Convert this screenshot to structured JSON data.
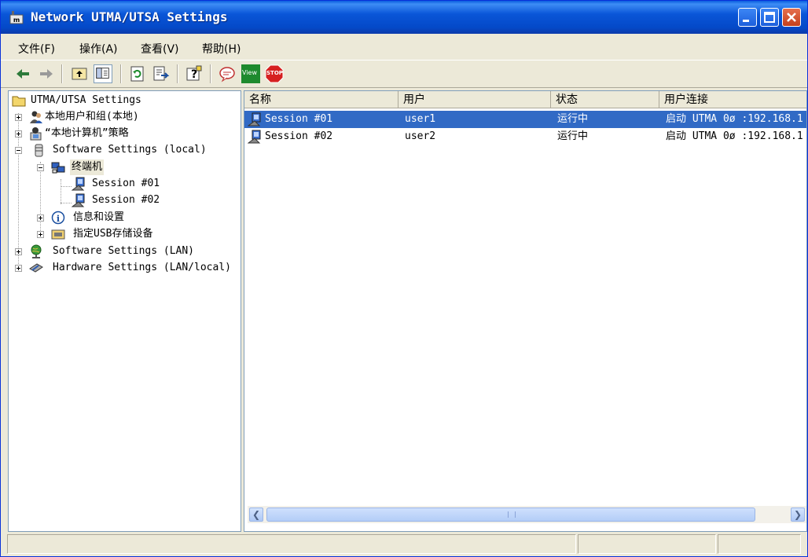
{
  "window": {
    "title": "Network UTMA/UTSA Settings",
    "colors": {
      "titlebar": "#0a56d8",
      "selection": "#316ac5",
      "close": "#c4401c"
    }
  },
  "menu": [
    {
      "label": "文件(F)"
    },
    {
      "label": "操作(A)"
    },
    {
      "label": "查看(V)"
    },
    {
      "label": "帮助(H)"
    }
  ],
  "toolbar": {
    "buttons": [
      "back-arrow-icon",
      "forward-arrow-icon",
      "up-folder-icon",
      "show-hide-tree-icon",
      "refresh-icon",
      "export-list-icon",
      "help-icon",
      "message-icon",
      "view-icon",
      "stop-icon"
    ],
    "view_label": "View",
    "stop_label": "STOP"
  },
  "tree": {
    "root": "UTMA/UTSA Settings",
    "items": [
      {
        "label": "本地用户和组(本地)",
        "icon": "users-icon"
      },
      {
        "label": "“本地计算机”策略",
        "icon": "policy-icon"
      },
      {
        "label": "Software Settings (local)",
        "icon": "database-icon"
      },
      {
        "label": "终端机",
        "icon": "terminal-icon"
      },
      {
        "label": "Session #01",
        "icon": "session-icon"
      },
      {
        "label": "Session #02",
        "icon": "session-icon"
      },
      {
        "label": "信息和设置",
        "icon": "info-icon"
      },
      {
        "label": "指定USB存储设备",
        "icon": "usb-storage-icon"
      },
      {
        "label": "Software Settings (LAN)",
        "icon": "globe-icon"
      },
      {
        "label": "Hardware Settings (LAN/local)",
        "icon": "hardware-icon"
      }
    ]
  },
  "list": {
    "columns": [
      "名称",
      "用户",
      "状态",
      "用户连接"
    ],
    "rows": [
      {
        "name": "Session #01",
        "user": "user1",
        "status": "运行中",
        "connection": "启动 UTMA 0ø :192.168.1"
      },
      {
        "name": "Session #02",
        "user": "user2",
        "status": "运行中",
        "connection": "启动 UTMA 0ø :192.168.1"
      }
    ]
  }
}
